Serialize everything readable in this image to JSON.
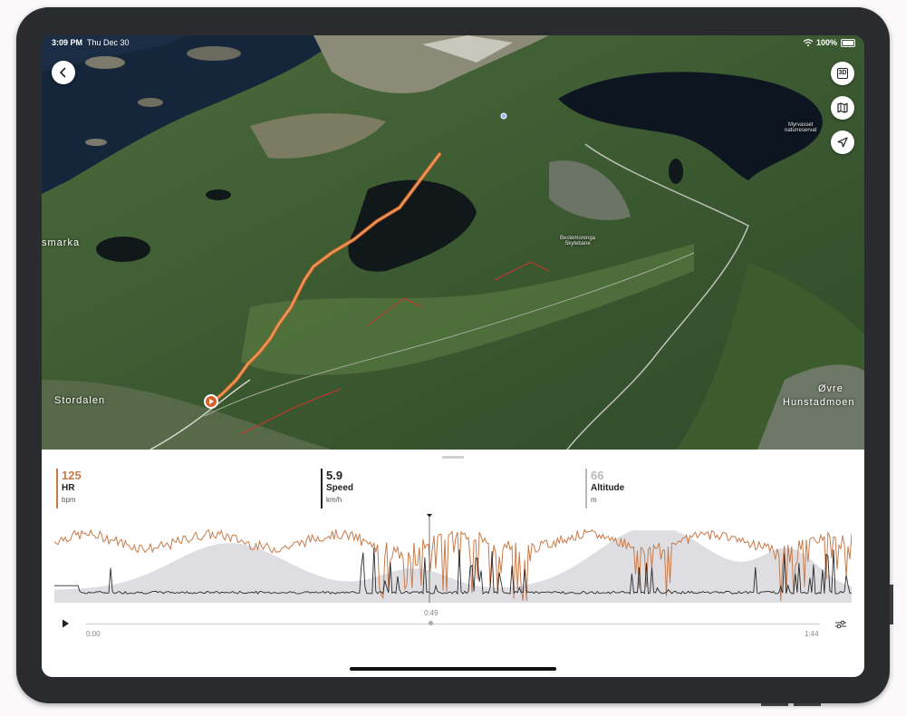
{
  "status_bar": {
    "time": "3:09 PM",
    "date": "Thu Dec 30",
    "battery": "100%"
  },
  "map": {
    "labels": {
      "stordalen": "Stordalen",
      "ovre": "Øvre",
      "hunstadmoen": "Hunstadmoen",
      "smarka": "smarka",
      "skytebane_1": "Bestemorenga",
      "skytebane_2": "Skytebane",
      "myrvasset_1": "Myrvasset",
      "myrvasset_2": "naturreservat"
    },
    "buttons": {
      "three_d": "3D"
    }
  },
  "metrics": [
    {
      "value": "125",
      "name": "HR",
      "unit": "bpm",
      "color": "#c87a4a"
    },
    {
      "value": "5.9",
      "name": "Speed",
      "unit": "km/h",
      "color": "#222222"
    },
    {
      "value": "66",
      "name": "Altitude",
      "unit": "m",
      "color": "#b9b9bd"
    }
  ],
  "playback": {
    "current_time": "0:49",
    "start_time": "0:00",
    "end_time": "1:44",
    "progress": 0.47
  },
  "colors": {
    "hr": "#c87a4a",
    "speed": "#2b2b2b",
    "altitude": "#dedee2",
    "route": "#e06a2a"
  }
}
